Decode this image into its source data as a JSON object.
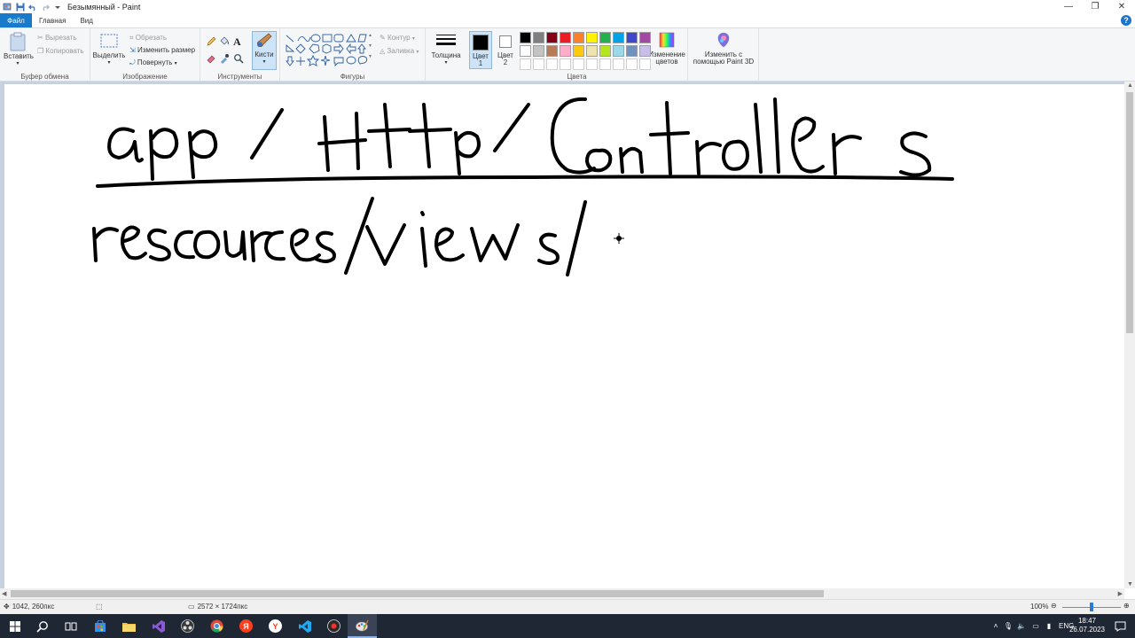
{
  "window": {
    "title": "Безымянный - Paint",
    "controls": [
      "—",
      "❐",
      "✕"
    ]
  },
  "menu": {
    "file": "Файл",
    "home": "Главная",
    "view": "Вид"
  },
  "ribbon": {
    "clipboard": {
      "label": "Буфер обмена",
      "paste": "Вставить",
      "cut": "Вырезать",
      "copy": "Копировать"
    },
    "image": {
      "label": "Изображение",
      "select": "Выделить",
      "crop": "Обрезать",
      "resize": "Изменить размер",
      "rotate": "Повернуть"
    },
    "tools": {
      "label": "Инструменты",
      "brushes": "Кисти"
    },
    "shapes": {
      "label": "Фигуры",
      "outline": "Контур",
      "fill": "Заливка"
    },
    "size": {
      "label": "Толщина"
    },
    "colors": {
      "label": "Цвета",
      "color1_line1": "Цвет",
      "color1_line2": "1",
      "color2_line1": "Цвет",
      "color2_line2": "2",
      "edit_line1": "Изменение",
      "edit_line2": "цветов",
      "paint3d_line1": "Изменить с",
      "paint3d_line2": "помощью Paint 3D",
      "color1_value": "#000000",
      "color2_value": "#ffffff",
      "palette": [
        "#000000",
        "#7f7f7f",
        "#880015",
        "#ed1c24",
        "#ff7f27",
        "#fff200",
        "#22b14c",
        "#00a2e8",
        "#3f48cc",
        "#a349a4",
        "#ffffff",
        "#c3c3c3",
        "#b97a57",
        "#ffaec9",
        "#ffc90e",
        "#efe4b0",
        "#b5e61d",
        "#99d9ea",
        "#7092be",
        "#c8bfe7"
      ]
    }
  },
  "canvas": {
    "drawing_text": "handwritten: app / Http / Controllers ; resources/views/"
  },
  "status": {
    "cursor_pos": "1042, 260пкс",
    "image_size": "2572 × 1724пкс",
    "zoom": "100%"
  },
  "taskbar": {
    "language": "ENG",
    "time": "18:47",
    "date": "26.07.2023"
  }
}
